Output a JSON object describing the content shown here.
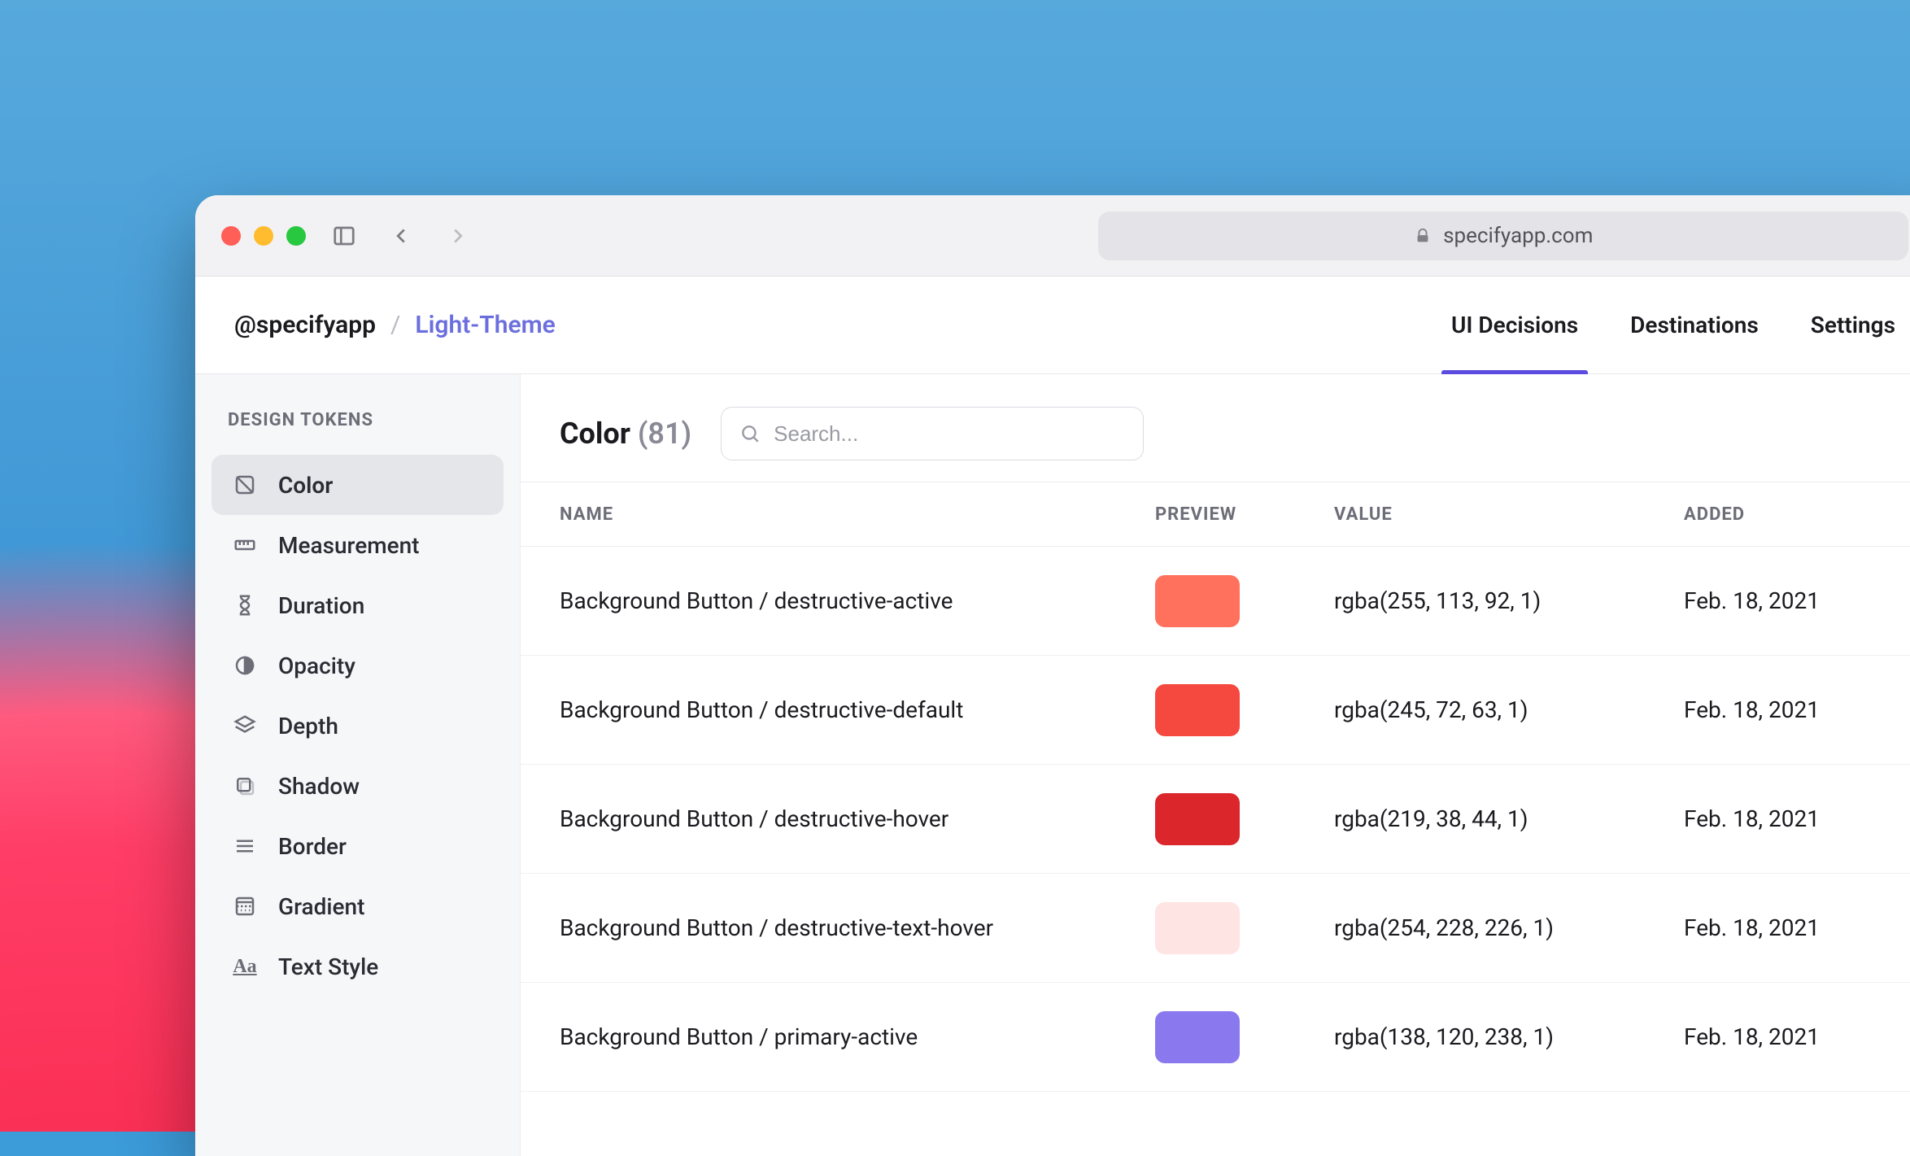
{
  "browser": {
    "url_host": "specifyapp.com"
  },
  "breadcrumb": {
    "org": "@specifyapp",
    "separator": "/",
    "project": "Light-Theme"
  },
  "tabs": [
    {
      "label": "UI Decisions",
      "active": true
    },
    {
      "label": "Destinations",
      "active": false
    },
    {
      "label": "Settings",
      "active": false
    }
  ],
  "sidebar": {
    "section_title": "DESIGN TOKENS",
    "items": [
      {
        "label": "Color",
        "icon": "palette-icon",
        "active": true
      },
      {
        "label": "Measurement",
        "icon": "ruler-icon",
        "active": false
      },
      {
        "label": "Duration",
        "icon": "hourglass-icon",
        "active": false
      },
      {
        "label": "Opacity",
        "icon": "contrast-icon",
        "active": false
      },
      {
        "label": "Depth",
        "icon": "layers-icon",
        "active": false
      },
      {
        "label": "Shadow",
        "icon": "shadow-icon",
        "active": false
      },
      {
        "label": "Border",
        "icon": "border-icon",
        "active": false
      },
      {
        "label": "Gradient",
        "icon": "gradient-icon",
        "active": false
      },
      {
        "label": "Text Style",
        "icon": "textstyle-icon",
        "active": false
      }
    ]
  },
  "main": {
    "title": "Color",
    "count_display": "(81)",
    "search_placeholder": "Search...",
    "columns": {
      "name": "NAME",
      "preview": "PREVIEW",
      "value": "VALUE",
      "added": "ADDED"
    },
    "rows": [
      {
        "name": "Background Button / destructive-active",
        "color": "#ff715c",
        "value": "rgba(255, 113, 92, 1)",
        "added": "Feb. 18, 2021"
      },
      {
        "name": "Background Button / destructive-default",
        "color": "#f5483f",
        "value": "rgba(245, 72, 63, 1)",
        "added": "Feb. 18, 2021"
      },
      {
        "name": "Background Button / destructive-hover",
        "color": "#db262c",
        "value": "rgba(219, 38, 44, 1)",
        "added": "Feb. 18, 2021"
      },
      {
        "name": "Background Button / destructive-text-hover",
        "color": "#fee4e2",
        "value": "rgba(254, 228, 226, 1)",
        "added": "Feb. 18, 2021"
      },
      {
        "name": "Background Button / primary-active",
        "color": "#8a78ee",
        "value": "rgba(138, 120, 238, 1)",
        "added": "Feb. 18, 2021"
      }
    ]
  }
}
